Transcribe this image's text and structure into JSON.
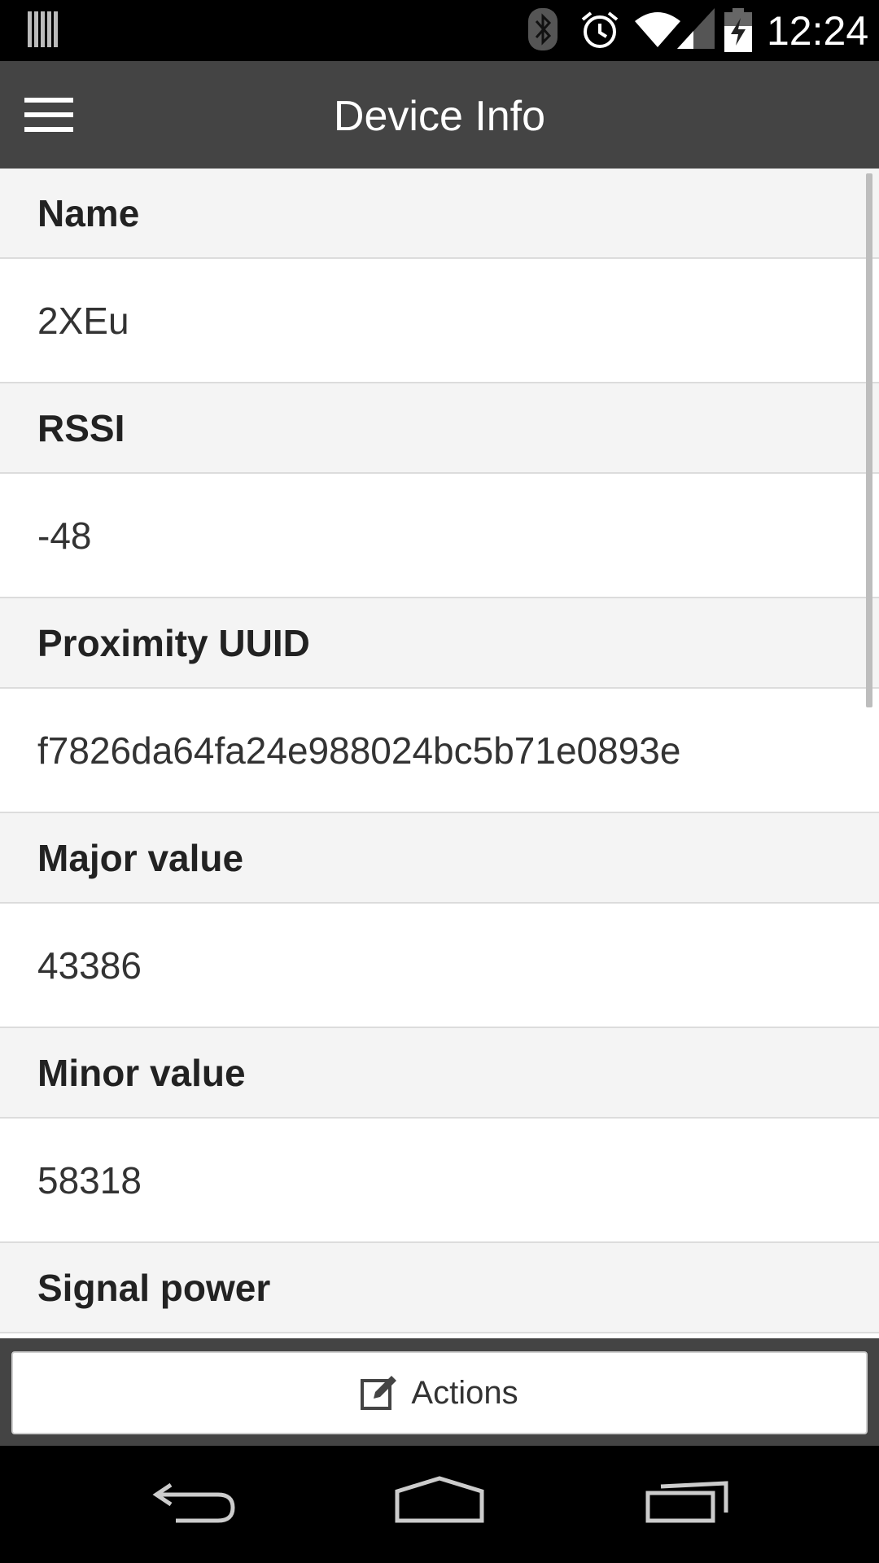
{
  "status_bar": {
    "time": "12:24",
    "icons": [
      "notification-barcode-icon",
      "bluetooth-icon",
      "alarm-icon",
      "wifi-icon",
      "cell-signal-icon",
      "battery-charging-icon"
    ]
  },
  "app_bar": {
    "title": "Device Info",
    "menu_icon": "hamburger-menu-icon"
  },
  "fields": [
    {
      "label": "Name",
      "value": "2XEu"
    },
    {
      "label": "RSSI",
      "value": "-48"
    },
    {
      "label": "Proximity UUID",
      "value": "f7826da64fa24e988024bc5b71e0893e"
    },
    {
      "label": "Major value",
      "value": "43386"
    },
    {
      "label": "Minor value",
      "value": "58318"
    },
    {
      "label": "Signal power",
      "value": ""
    }
  ],
  "actions": {
    "label": "Actions",
    "icon": "edit-icon"
  },
  "nav": {
    "icons": [
      "back-icon",
      "home-icon",
      "recents-icon"
    ]
  },
  "colors": {
    "app_bar": "#444444",
    "label_row_bg": "#f4f4f4",
    "divider": "#dcdcdc"
  }
}
